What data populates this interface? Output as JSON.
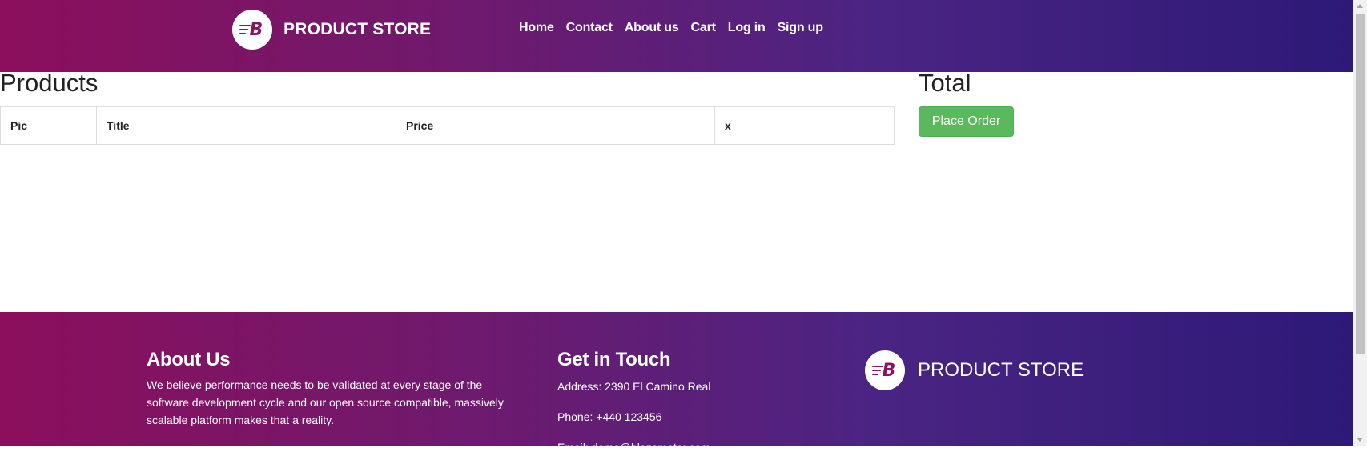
{
  "navbar": {
    "brand": "PRODUCT STORE",
    "links": [
      "Home",
      "Contact",
      "About us",
      "Cart",
      "Log in",
      "Sign up"
    ]
  },
  "main": {
    "products_title": "Products",
    "table_headers": [
      "Pic",
      "Title",
      "Price",
      "x"
    ],
    "total_title": "Total",
    "place_order_label": "Place Order"
  },
  "footer": {
    "about_title": "About Us",
    "about_text": "We believe performance needs to be validated at every stage of the software development cycle and our open source compatible, massively scalable platform makes that a reality.",
    "touch_title": "Get in Touch",
    "address": "Address: 2390 El Camino Real",
    "phone": "Phone: +440 123456",
    "email": "Email: demo@blazemeter.com",
    "brand": "PRODUCT STORE"
  },
  "colors": {
    "gradient_start": "#8b0f5c",
    "gradient_end": "#2d1977",
    "button_green": "#5cb85c"
  },
  "icons": {
    "logo": "blazemeter-logo-icon"
  }
}
